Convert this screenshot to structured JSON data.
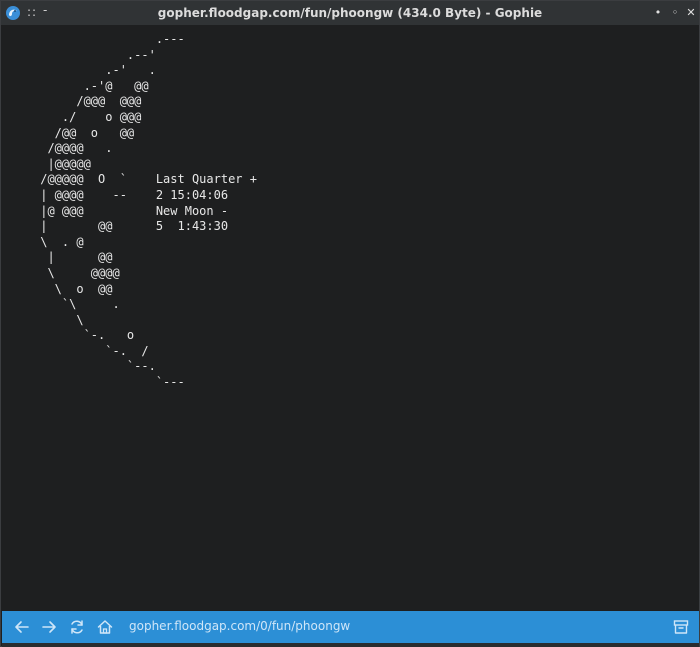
{
  "window": {
    "title": "gopher.floodgap.com/fun/phoongw (434.0 Byte) - Gophie",
    "grip": "::",
    "minimize_dash": "-",
    "buttons": {
      "minimize": "•",
      "maximize": "◦",
      "close": "✕"
    }
  },
  "content": {
    "text_lines": [
      "                 .---",
      "             .--'",
      "          .-'   .",
      "       .-'@   @@",
      "      /@@@  @@@",
      "    ./    o @@@",
      "   /@@  o   @@",
      "  /@@@@   .",
      "  |@@@@@",
      " /@@@@@  O  `    Last Quarter +",
      " | @@@@    --    2 15:04:06",
      " |@ @@@          New Moon -",
      " |       @@      5  1:43:30",
      " \\  . @",
      "  |      @@",
      "  \\     @@@@",
      "   \\  o  @@",
      "    `\\     .",
      "      \\",
      "       `-.   o",
      "          `-.  /",
      "             `--.",
      "                 `---"
    ]
  },
  "navbar": {
    "address": "gopher.floodgap.com/0/fun/phoongw",
    "icons": {
      "back": "back-arrow-icon",
      "forward": "forward-arrow-icon",
      "refresh": "refresh-icon",
      "home": "home-icon",
      "menu": "archive-icon"
    }
  },
  "colors": {
    "accent": "#2c8fd6",
    "background": "#1e1f20",
    "titlebar": "#303335",
    "text": "#e8e8e8"
  }
}
